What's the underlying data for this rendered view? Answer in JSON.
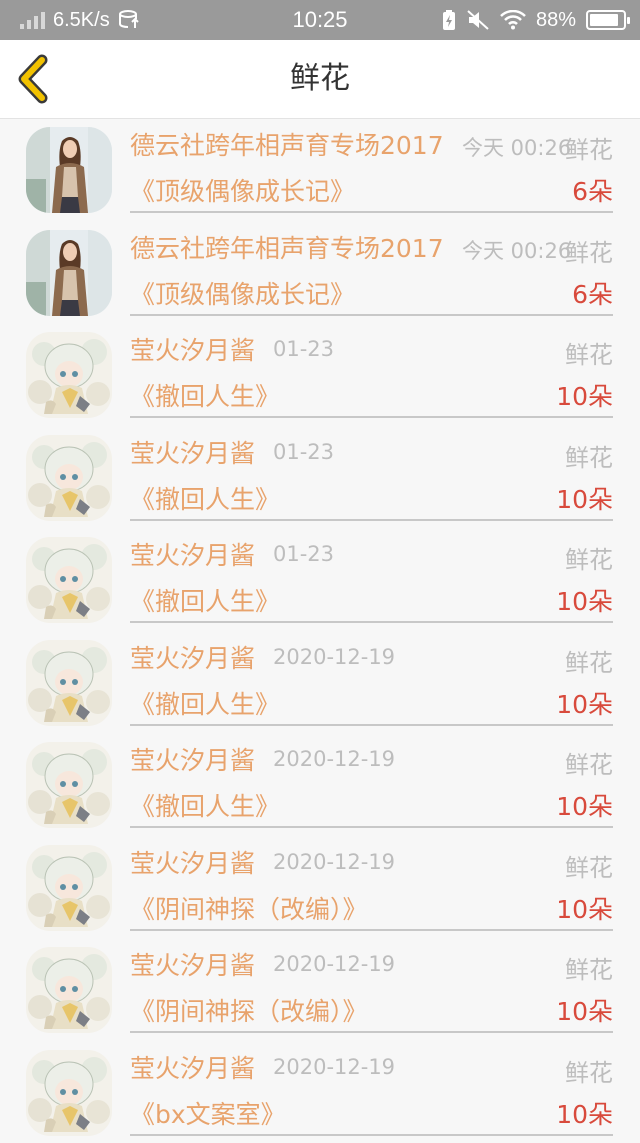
{
  "status_bar": {
    "network_speed": "6.5K/s",
    "time": "10:25",
    "battery": "88%",
    "battery_level": 0.88,
    "icons": [
      "signal-icon",
      "data-icon",
      "charging-icon",
      "mute-icon",
      "wifi-icon",
      "battery-icon"
    ]
  },
  "header": {
    "back_icon": "chevron-left-icon",
    "title": "鲜花"
  },
  "colors": {
    "accent": "#e8a36c",
    "count": "#d84a3c",
    "muted": "#bdbdbd",
    "back_icon": "#f2c200"
  },
  "records": [
    {
      "avatar": "photo-woman",
      "name": "德云社跨年相声育专场2017",
      "time": "今天 00:26",
      "gift": "鲜花",
      "book": "《顶级偶像成长记》",
      "count": "6朵"
    },
    {
      "avatar": "photo-woman",
      "name": "德云社跨年相声育专场2017",
      "time": "今天 00:26",
      "gift": "鲜花",
      "book": "《顶级偶像成长记》",
      "count": "6朵"
    },
    {
      "avatar": "anime-girl",
      "name": "莹火汐月酱",
      "time": "01-23",
      "gift": "鲜花",
      "book": "《撤回人生》",
      "count": "10朵"
    },
    {
      "avatar": "anime-girl",
      "name": "莹火汐月酱",
      "time": "01-23",
      "gift": "鲜花",
      "book": "《撤回人生》",
      "count": "10朵"
    },
    {
      "avatar": "anime-girl",
      "name": "莹火汐月酱",
      "time": "01-23",
      "gift": "鲜花",
      "book": "《撤回人生》",
      "count": "10朵"
    },
    {
      "avatar": "anime-girl",
      "name": "莹火汐月酱",
      "time": "2020-12-19",
      "gift": "鲜花",
      "book": "《撤回人生》",
      "count": "10朵"
    },
    {
      "avatar": "anime-girl",
      "name": "莹火汐月酱",
      "time": "2020-12-19",
      "gift": "鲜花",
      "book": "《撤回人生》",
      "count": "10朵"
    },
    {
      "avatar": "anime-girl",
      "name": "莹火汐月酱",
      "time": "2020-12-19",
      "gift": "鲜花",
      "book": "《阴间神探（改编）》",
      "count": "10朵"
    },
    {
      "avatar": "anime-girl",
      "name": "莹火汐月酱",
      "time": "2020-12-19",
      "gift": "鲜花",
      "book": "《阴间神探（改编）》",
      "count": "10朵"
    },
    {
      "avatar": "anime-girl",
      "name": "莹火汐月酱",
      "time": "2020-12-19",
      "gift": "鲜花",
      "book": "《bx文案室》",
      "count": "10朵"
    }
  ]
}
